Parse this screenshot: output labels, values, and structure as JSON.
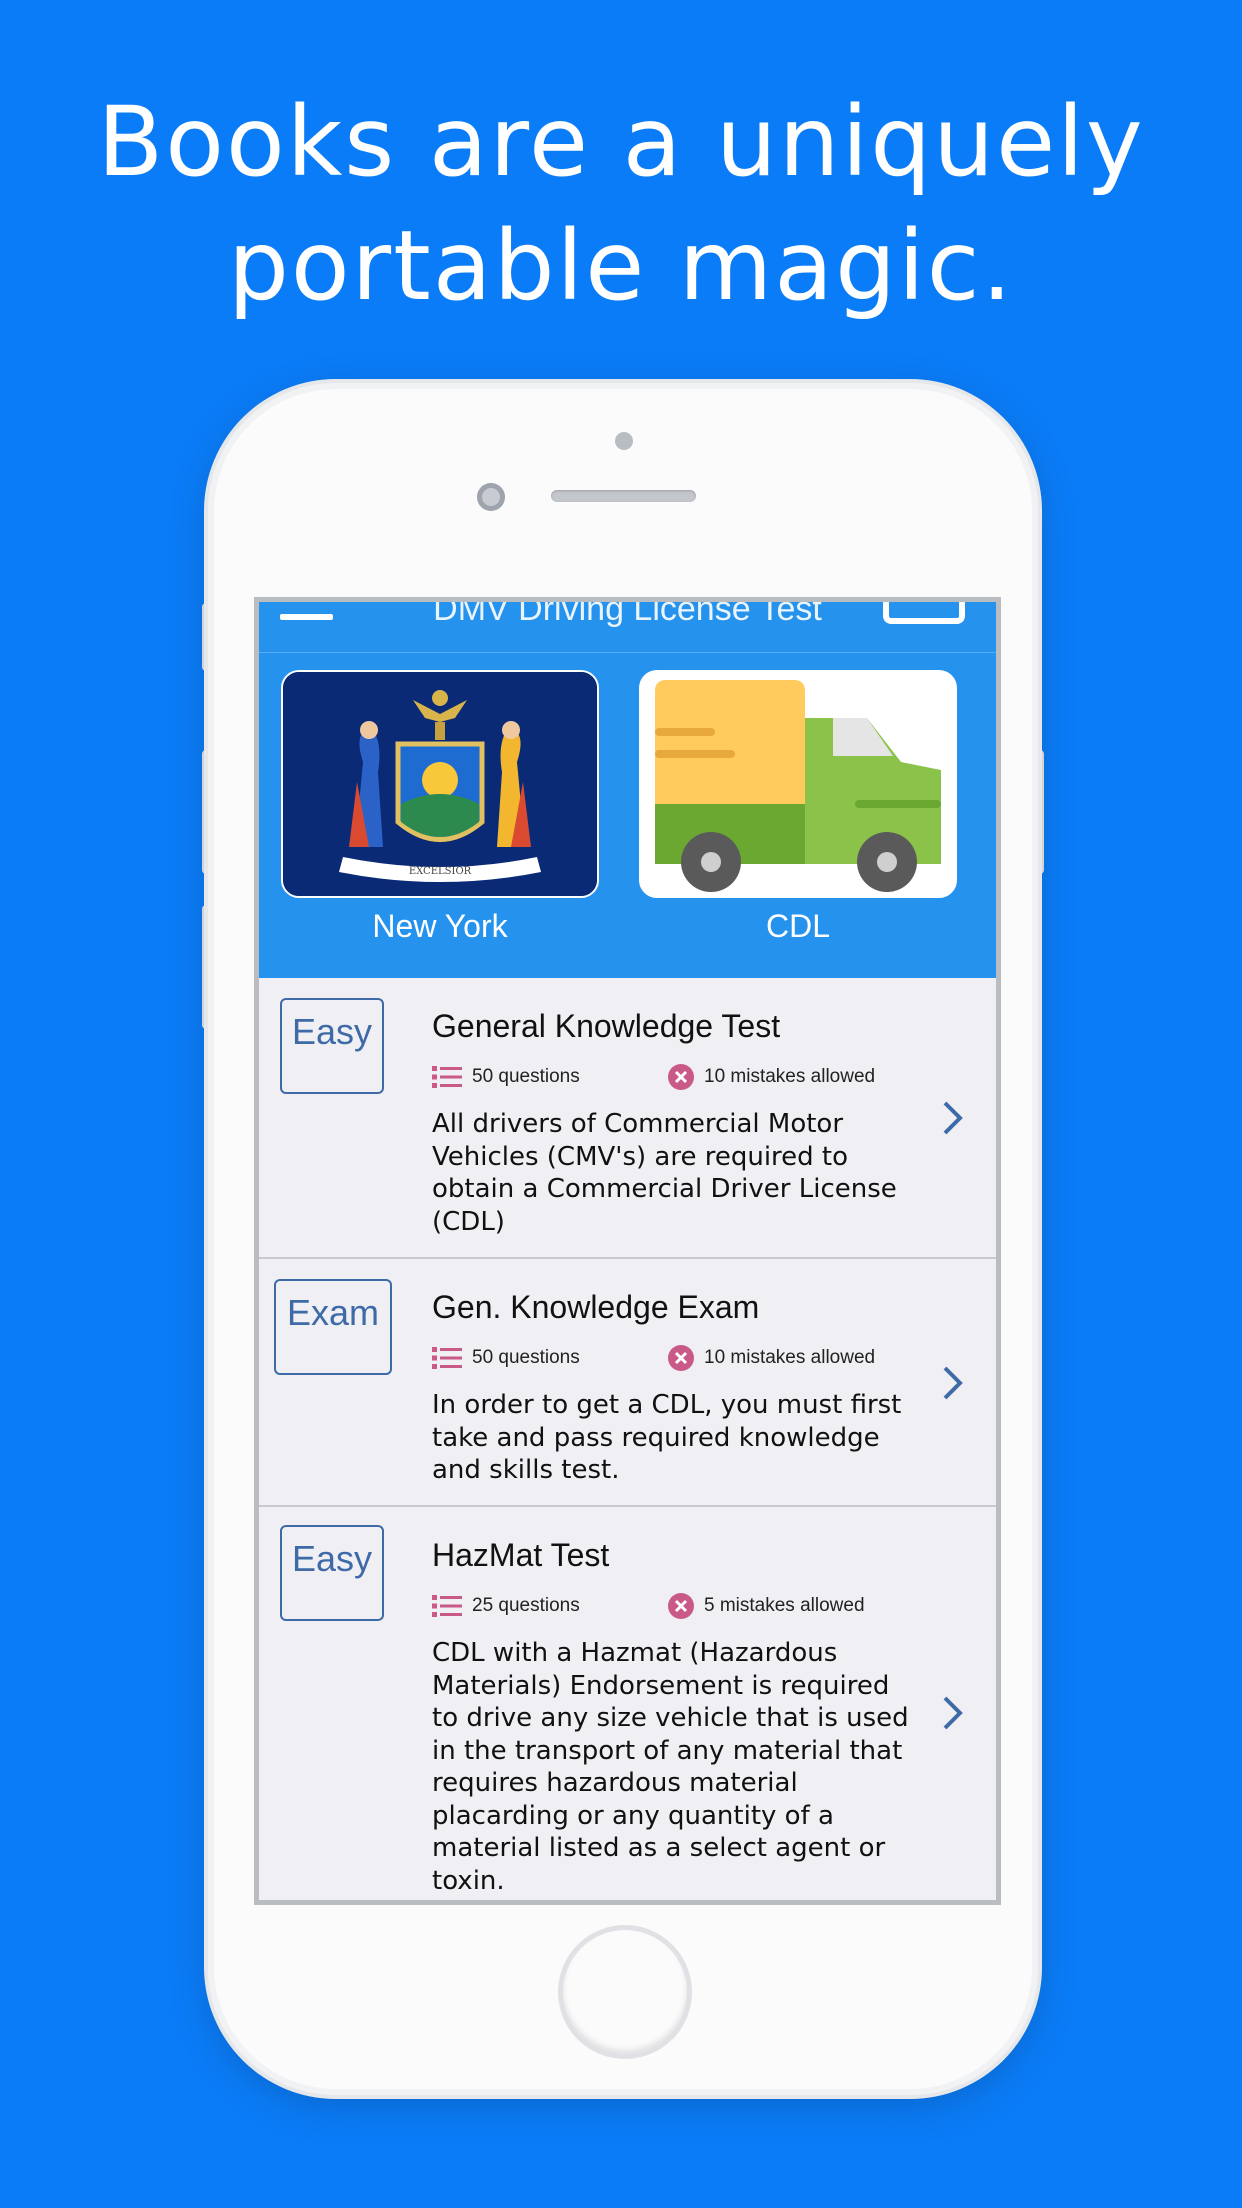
{
  "headline": {
    "line1": "Books are a uniquely",
    "line2": "portable magic."
  },
  "app": {
    "title": "DMV Driving License Test",
    "accent_color": "#2592ed",
    "icons": [
      "menu-icon",
      "vr-glasses-icon",
      "list-icon",
      "error-icon",
      "chevron-right-icon"
    ]
  },
  "categories": [
    {
      "label": "New York",
      "image": "new-york-seal"
    },
    {
      "label": "CDL",
      "image": "truck"
    }
  ],
  "tests": [
    {
      "badge": "Easy",
      "title": "General Knowledge Test",
      "questions": "50 questions",
      "mistakes": "10 mistakes allowed",
      "description": "All drivers of Commercial Motor Vehicles (CMV's) are required to obtain a Commercial Driver License (CDL)"
    },
    {
      "badge": "Exam",
      "title": "Gen. Knowledge Exam",
      "questions": "50 questions",
      "mistakes": "10 mistakes allowed",
      "description": "In order to get a CDL, you must first take and pass required knowledge and skills test."
    },
    {
      "badge": "Easy",
      "title": "HazMat Test",
      "questions": "25 questions",
      "mistakes": "5 mistakes allowed",
      "description": "CDL with a Hazmat (Hazardous Materials) Endorsement is required to drive any size vehicle that is used in the transport of any material that requires hazardous material placarding or any quantity of a material listed as a select agent or toxin."
    }
  ]
}
